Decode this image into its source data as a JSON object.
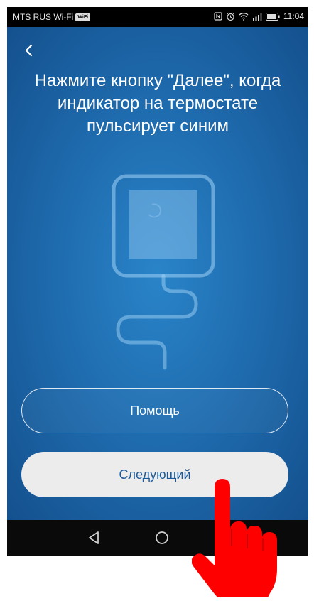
{
  "status_bar": {
    "carrier": "MTS RUS Wi-Fi",
    "wifi_badge": "WiFi",
    "time": "11:04"
  },
  "header": {
    "back_icon": "chevron-left-icon"
  },
  "main": {
    "instruction": "Нажмите кнопку \"Далее\", когда индикатор на термостате пульсирует синим",
    "illustration": "thermostat-icon"
  },
  "buttons": {
    "help_label": "Помощь",
    "next_label": "Следующий"
  },
  "nav_bar": {
    "back": "triangle-back-icon",
    "home": "circle-home-icon"
  },
  "overlay": {
    "pointer": "pointing-hand-icon",
    "color": "#ff0000"
  },
  "colors": {
    "screen_bg": "#1f6db0",
    "next_button_bg": "#ececec",
    "next_button_text": "#1a5a9a"
  }
}
